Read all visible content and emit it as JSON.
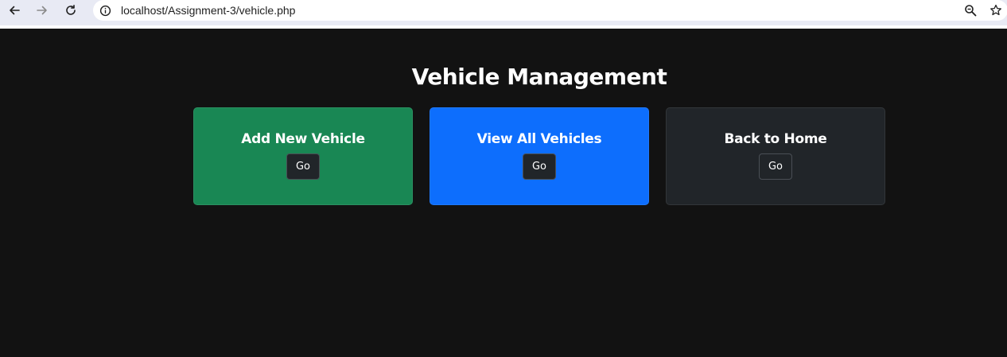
{
  "browser": {
    "url": "localhost/Assignment-3/vehicle.php",
    "icons": [
      "back-arrow-icon",
      "forward-arrow-icon",
      "reload-icon",
      "info-icon",
      "zoom-icon",
      "bookmark-star-icon"
    ]
  },
  "page": {
    "title": "Vehicle Management"
  },
  "cards": [
    {
      "title": "Add New Vehicle",
      "button_label": "Go",
      "color": "#198754"
    },
    {
      "title": "View All Vehicles",
      "button_label": "Go",
      "color": "#0d6efd"
    },
    {
      "title": "Back to Home",
      "button_label": "Go",
      "color": "#212529"
    }
  ],
  "colors": {
    "background": "#121212",
    "browser_bar": "#e8eaf4",
    "button": "#212529"
  }
}
